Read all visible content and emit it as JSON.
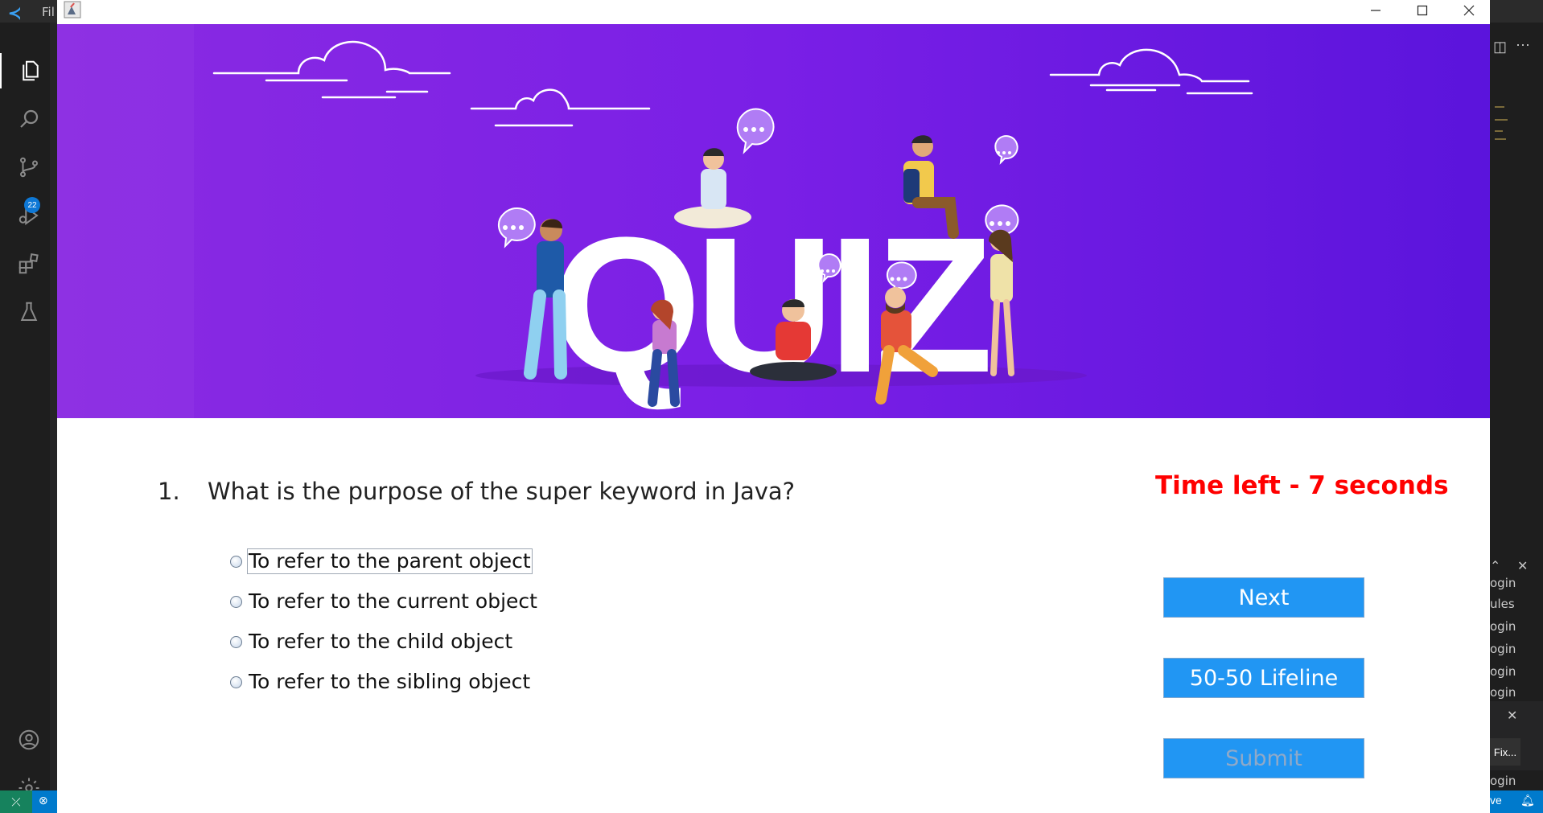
{
  "vscode": {
    "file_menu": "Fil",
    "debug_badge": "22",
    "panel_lines": [
      "ogin",
      "ules",
      "ogin",
      "ogin",
      "ogin",
      "ogin"
    ],
    "notification_button": "Fix...",
    "panel_bottom": "ogin",
    "status_right": "ve"
  },
  "quiz": {
    "question_number": "1.",
    "question": "What is the purpose of the super keyword in Java?",
    "timer": "Time left - 7 seconds",
    "options": [
      "To refer to the parent object",
      "To refer to the current object",
      "To refer to the child object",
      "To refer to the sibling object"
    ],
    "buttons": {
      "next": "Next",
      "lifeline": "50-50 Lifeline",
      "submit": "Submit"
    },
    "banner_text": "QUIZ",
    "colors": {
      "banner_start": "#8a2be2",
      "banner_end": "#5b14dc",
      "timer": "#ff0000",
      "button": "#2196f3"
    }
  }
}
